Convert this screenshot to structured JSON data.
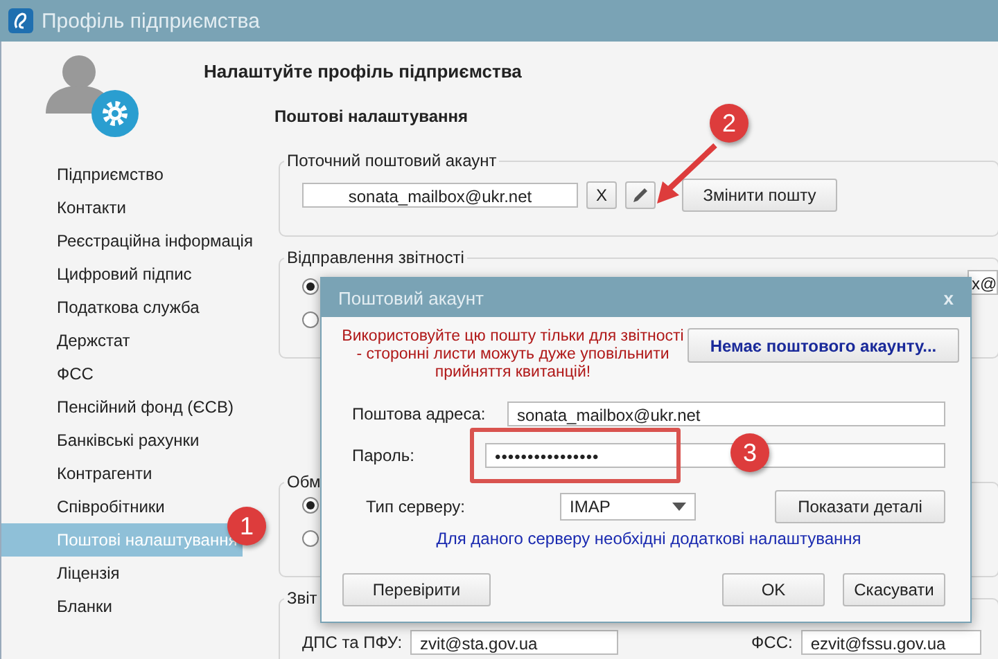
{
  "window": {
    "title": "Профіль підприємства"
  },
  "header": "Налаштуйте профіль підприємства",
  "sidebar": {
    "items": [
      {
        "label": "Підприємство",
        "selected": false
      },
      {
        "label": "Контакти",
        "selected": false
      },
      {
        "label": "Реєстраційна інформація",
        "selected": false
      },
      {
        "label": "Цифровий підпис",
        "selected": false
      },
      {
        "label": "Податкова служба",
        "selected": false
      },
      {
        "label": "Держстат",
        "selected": false
      },
      {
        "label": "ФСС",
        "selected": false
      },
      {
        "label": "Пенсійний фонд (ЄСВ)",
        "selected": false
      },
      {
        "label": "Банківські рахунки",
        "selected": false
      },
      {
        "label": "Контрагенти",
        "selected": false
      },
      {
        "label": "Співробітники",
        "selected": false
      },
      {
        "label": "Поштові налаштування",
        "selected": true
      },
      {
        "label": "Ліцензія",
        "selected": false
      },
      {
        "label": "Бланки",
        "selected": false
      }
    ]
  },
  "section_title": "Поштові налаштування",
  "current_account": {
    "legend": "Поточний поштовий акаунт",
    "email": "sonata_mailbox@ukr.net",
    "clear_button": "X",
    "change_button": "Змінити пошту"
  },
  "sending": {
    "legend": "Відправлення звітності",
    "options": [
      {
        "selected": true
      },
      {
        "selected": false
      }
    ],
    "field_value": "x@"
  },
  "exchange": {
    "legend": "Обм",
    "options": [
      {
        "selected": true
      },
      {
        "selected": false
      }
    ]
  },
  "reports": {
    "legend": "Звіт",
    "fields": [
      {
        "label": "ДПС та ПФУ:",
        "value": "zvit@sta.gov.ua"
      },
      {
        "label": "ФСС:",
        "value": "ezvit@fssu.gov.ua"
      }
    ]
  },
  "dialog": {
    "title": "Поштовий акаунт",
    "close": "x",
    "warning": "Використовуйте цю пошту тільки для звітності - сторонні листи можуть дуже уповільнити прийняття квитанцій!",
    "no_account_button": "Немає поштового акаунту...",
    "address_label": "Поштова адреса:",
    "address_value": "sonata_mailbox@ukr.net",
    "password_label": "Пароль:",
    "password_value": "••••••••••••••••",
    "server_label": "Тип серверу:",
    "server_value": "IMAP",
    "details_button": "Показати деталі",
    "server_note": "Для даного серверу необхідні додаткові налаштування",
    "check_button": "Перевірити",
    "ok_button": "OK",
    "cancel_button": "Скасувати"
  },
  "annotations": [
    {
      "number": "1"
    },
    {
      "number": "2"
    },
    {
      "number": "3"
    }
  ]
}
